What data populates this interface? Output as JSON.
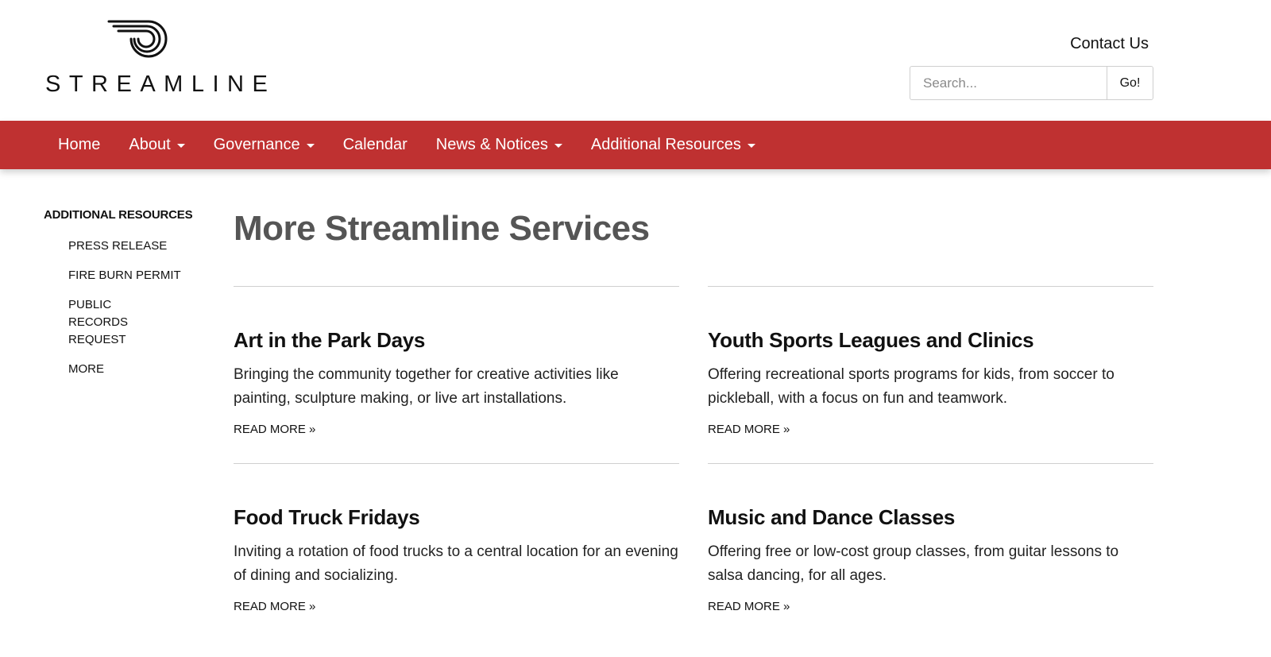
{
  "header": {
    "logo_text": "STREAMLINE",
    "contact_label": "Contact Us",
    "search_placeholder": "Search...",
    "search_button": "Go!"
  },
  "nav": {
    "items": [
      {
        "label": "Home",
        "dropdown": false
      },
      {
        "label": "About",
        "dropdown": true
      },
      {
        "label": "Governance",
        "dropdown": true
      },
      {
        "label": "Calendar",
        "dropdown": false
      },
      {
        "label": "News & Notices",
        "dropdown": true
      },
      {
        "label": "Additional Resources",
        "dropdown": true
      }
    ],
    "color": "#bf3131"
  },
  "sidebar": {
    "title": "ADDITIONAL RESOURCES",
    "links": [
      "PRESS RELEASE",
      "FIRE BURN PERMIT",
      "PUBLIC RECORDS REQUEST",
      "MORE"
    ]
  },
  "main": {
    "title": "More Streamline Services",
    "cards": [
      {
        "title": "Art in the Park Days",
        "text": "Bringing the community together for creative activities like painting, sculpture making, or live art installations.",
        "link": "READ MORE »"
      },
      {
        "title": "Youth Sports Leagues and Clinics",
        "text": "Offering recreational sports programs for kids, from soccer to pickleball, with a focus on fun and teamwork.",
        "link": "READ MORE »"
      },
      {
        "title": "Food Truck Fridays",
        "text": "Inviting a rotation of food trucks to a central location for an evening of dining and socializing.",
        "link": "READ MORE »"
      },
      {
        "title": "Music and Dance Classes",
        "text": "Offering free or low-cost group classes, from guitar lessons to salsa dancing, for all ages.",
        "link": "READ MORE »"
      }
    ]
  }
}
